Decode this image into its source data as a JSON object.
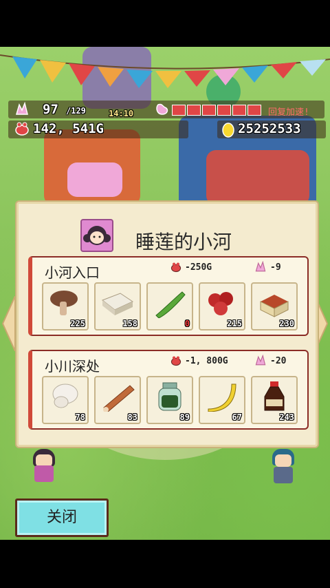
{
  "hud": {
    "stamina_current": "97",
    "stamina_max": "/129",
    "time": "14:10",
    "recover_label": "回复加速!",
    "money": "142, 541G",
    "eggs": "25252533",
    "hunger_segments_filled": 6
  },
  "dialog": {
    "title": "睡莲的小河",
    "sections": [
      {
        "name": "小河入口",
        "money_cost": "-250G",
        "stamina_cost": "-9",
        "items": [
          {
            "icon": "mushroom-icon",
            "count": "225"
          },
          {
            "icon": "tofu-icon",
            "count": "158"
          },
          {
            "icon": "green-pepper-icon",
            "count": "0"
          },
          {
            "icon": "berries-icon",
            "count": "215"
          },
          {
            "icon": "spice-box-icon",
            "count": "230"
          }
        ]
      },
      {
        "name": "小川深处",
        "money_cost": "-1, 800G",
        "stamina_cost": "-20",
        "items": [
          {
            "icon": "white-mushroom-icon",
            "count": "78"
          },
          {
            "icon": "cinnamon-stick-icon",
            "count": "83"
          },
          {
            "icon": "herb-jar-icon",
            "count": "89"
          },
          {
            "icon": "banana-icon",
            "count": "67"
          },
          {
            "icon": "soy-sauce-icon",
            "count": "243"
          }
        ]
      }
    ]
  },
  "close_label": "关闭",
  "colors": {
    "panel_bg": "#f4ebcf",
    "section_border": "#8b2c26",
    "close_button": "#7fe0e4",
    "hunger_fill": "#e04646"
  }
}
